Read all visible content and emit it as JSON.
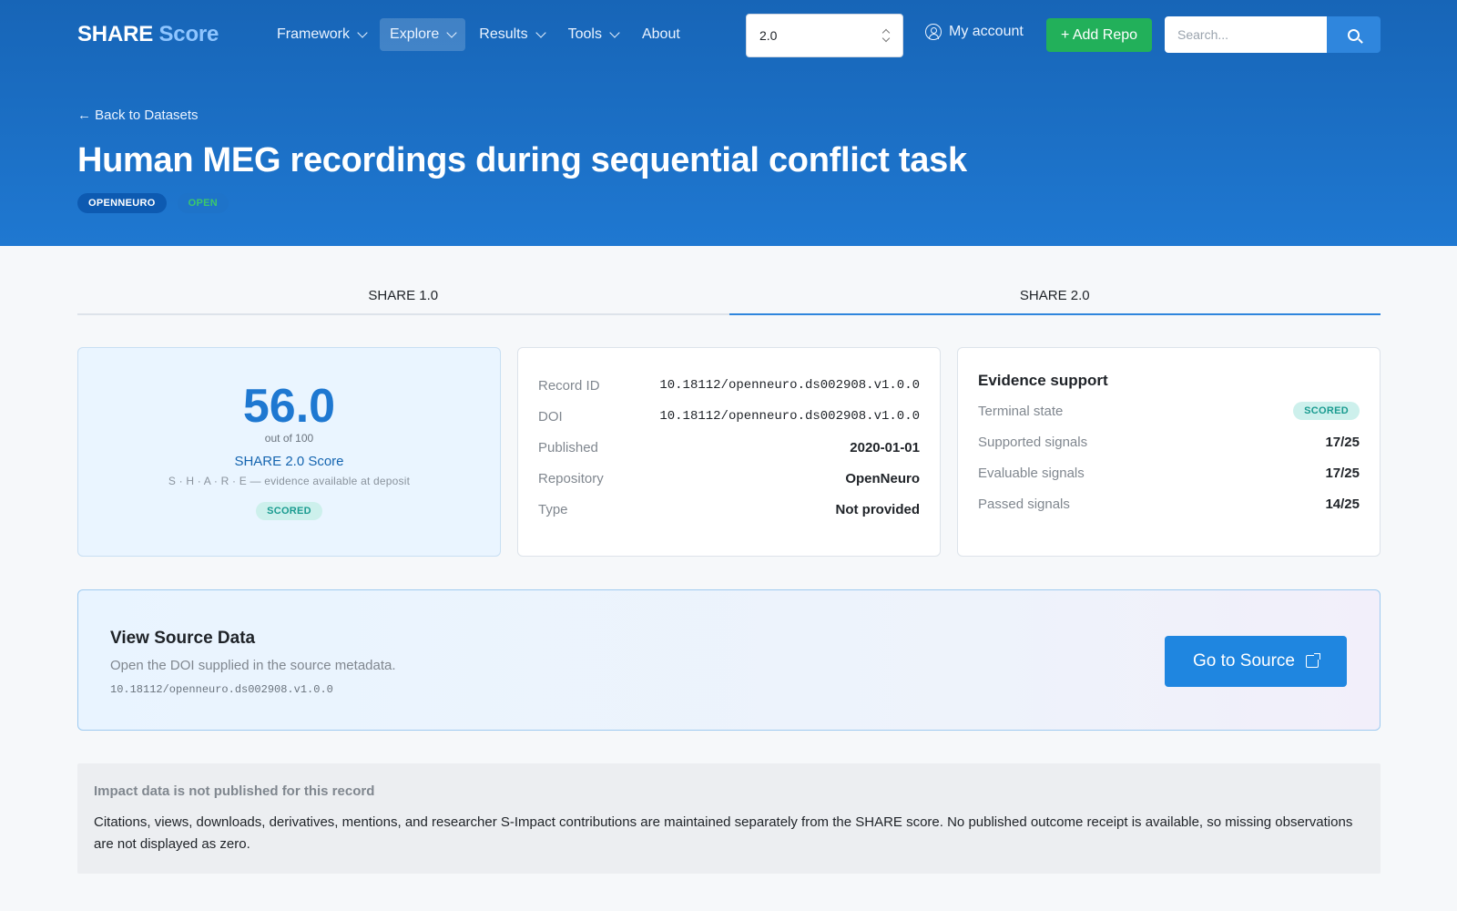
{
  "nav": {
    "brand_part1": "SHARE",
    "brand_part2": "Score",
    "menu": [
      {
        "label": "Framework"
      },
      {
        "label": "Explore"
      },
      {
        "label": "Results"
      },
      {
        "label": "Tools"
      },
      {
        "label": "About"
      }
    ],
    "active_menu": "Explore",
    "version_value": "2.0",
    "account_label": "My account",
    "add_repo_label": "+ Add Repo",
    "search_placeholder": "Search..."
  },
  "hero": {
    "back_label": "← Back to Datasets",
    "title": "Human MEG recordings during sequential conflict task",
    "badges": [
      "OPENNEURO",
      "OPEN"
    ]
  },
  "tabs": [
    {
      "label": "SHARE 1.0",
      "active": false
    },
    {
      "label": "SHARE 2.0",
      "active": true
    }
  ],
  "score": {
    "value": "56.0",
    "out_of": "out of 100",
    "label": "SHARE 2.0 Score",
    "subtitle": "S · H · A · R · E — evidence available at deposit",
    "status": "SCORED"
  },
  "metadata": [
    {
      "key": "Record ID",
      "value": "10.18112/openneuro.ds002908.v1.0.0"
    },
    {
      "key": "DOI",
      "value": "10.18112/openneuro.ds002908.v1.0.0"
    },
    {
      "key": "Published",
      "value": "2020-01-01"
    },
    {
      "key": "Repository",
      "value": "OpenNeuro"
    },
    {
      "key": "Type",
      "value": "Not provided"
    }
  ],
  "evidence": {
    "title": "Evidence support",
    "terminal_state_label": "Terminal state",
    "terminal_state_value": "SCORED",
    "rows": [
      {
        "key": "Supported signals",
        "value": "17/25"
      },
      {
        "key": "Evaluable signals",
        "value": "17/25"
      },
      {
        "key": "Passed signals",
        "value": "14/25"
      }
    ]
  },
  "source": {
    "title": "View Source Data",
    "description": "Open the DOI supplied in the source metadata.",
    "doi": "10.18112/openneuro.ds002908.v1.0.0",
    "button_label": "Go to Source"
  },
  "impact": {
    "title": "Impact data is not published for this record",
    "body": "Citations, views, downloads, derivatives, mentions, and researcher S-Impact contributions are maintained separately from the SHARE score. No published outcome receipt is available, so missing observations are not displayed as zero."
  },
  "colors": {
    "header_blue": "#1f78d1",
    "accent": "#1f86e0",
    "success": "#22b05a",
    "scored_teal": "#1a9b90"
  }
}
